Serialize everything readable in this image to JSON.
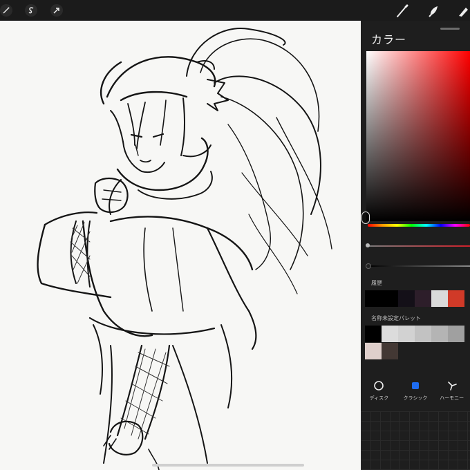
{
  "toolbar": {
    "left_icons": [
      "adjustments-wand-icon",
      "selection-s-icon",
      "transform-arrow-icon"
    ],
    "right_icons": [
      "brush-icon",
      "smudge-icon",
      "eraser-icon"
    ]
  },
  "color_panel": {
    "title": "カラー",
    "current_color": "#ff0000",
    "history_label": "履歴",
    "history_swatches": [
      "#000000",
      "#000000",
      "#141018",
      "#2d1e2a",
      "#dadada",
      "#d03a28"
    ],
    "palette_label": "名称未設定パレット",
    "palette_rows": [
      [
        "#000000",
        "#dcdcdc",
        "#d2d2d2",
        "#c2c2c2",
        "#b4b4b4",
        "#a0a0a0"
      ],
      [
        "#dfcfcb",
        "#433834",
        "#1e1e1e",
        "#1e1e1e",
        "#1e1e1e",
        "#1e1e1e"
      ]
    ],
    "modes": [
      {
        "label": "ディスク",
        "icon": "circle-icon",
        "active": false
      },
      {
        "label": "クラシック",
        "icon": "square-icon",
        "active": true
      },
      {
        "label": "ハーモニー",
        "icon": "harmony-icon",
        "active": false
      }
    ]
  },
  "colors": {
    "accent": "#1e6cf0",
    "panel_bg": "#1e1e1e",
    "canvas_bg": "#f7f7f5"
  }
}
